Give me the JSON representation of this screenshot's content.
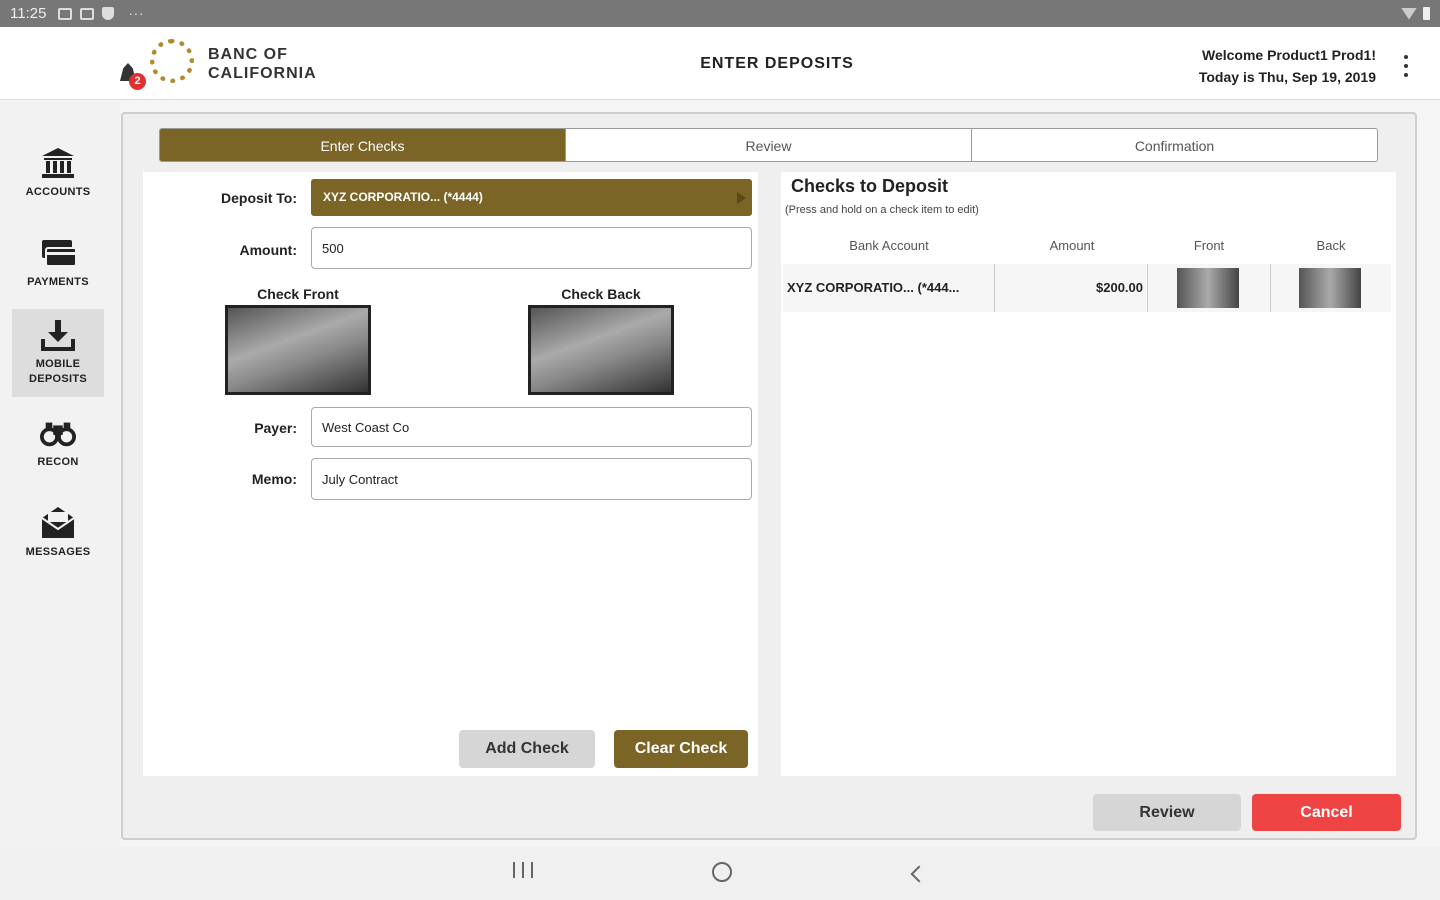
{
  "status_bar": {
    "time": "11:25",
    "more": "···"
  },
  "header": {
    "logo_line1": "BANC OF",
    "logo_line2": "CALIFORNIA",
    "title": "ENTER DEPOSITS",
    "welcome": "Welcome Product1 Prod1!",
    "date": "Today is Thu, Sep 19, 2019",
    "alert_count": "2"
  },
  "nav": [
    {
      "label": "ACCOUNTS"
    },
    {
      "label": "PAYMENTS"
    },
    {
      "label": "MOBILE DEPOSITS"
    },
    {
      "label": "RECON"
    },
    {
      "label": "MESSAGES"
    }
  ],
  "steps": [
    "Enter Checks",
    "Review",
    "Confirmation"
  ],
  "form": {
    "deposit_to_label": "Deposit To:",
    "deposit_to_value": "XYZ CORPORATIO... (*4444)",
    "amount_label": "Amount:",
    "amount_value": "500",
    "check_front_label": "Check Front",
    "check_back_label": "Check Back",
    "payer_label": "Payer:",
    "payer_value": "West Coast Co",
    "memo_label": "Memo:",
    "memo_value": "July Contract"
  },
  "buttons": {
    "add_check": "Add Check",
    "clear_check": "Clear Check",
    "review": "Review",
    "cancel": "Cancel"
  },
  "checks_panel": {
    "title": "Checks to Deposit",
    "hint": "(Press and hold on a check item to edit)",
    "columns": [
      "Bank Account",
      "Amount",
      "Front",
      "Back"
    ],
    "rows": [
      {
        "account": "XYZ CORPORATIO... (*444...",
        "amount": "$200.00"
      }
    ]
  },
  "colors": {
    "brand_gold": "#7a6426",
    "cancel_red": "#ee4444"
  }
}
